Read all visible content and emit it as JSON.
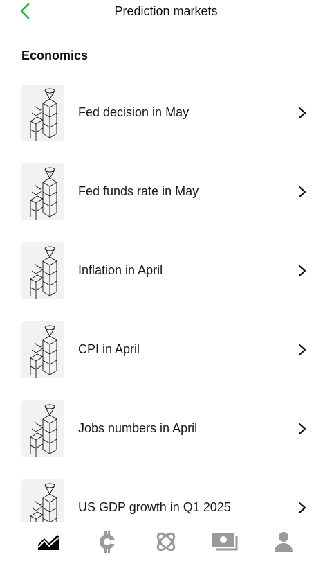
{
  "header": {
    "title": "Prediction markets",
    "back_icon": "chevron-left-icon",
    "accent_color": "#1db83a"
  },
  "section": {
    "title": "Economics"
  },
  "markets": [
    {
      "label": "Fed decision in May",
      "icon": "isometric-blocks-icon"
    },
    {
      "label": "Fed funds rate in May",
      "icon": "isometric-blocks-icon"
    },
    {
      "label": "Inflation in April",
      "icon": "isometric-blocks-icon"
    },
    {
      "label": "CPI in April",
      "icon": "isometric-blocks-icon"
    },
    {
      "label": "Jobs numbers in April",
      "icon": "isometric-blocks-icon"
    },
    {
      "label": "US GDP growth in Q1 2025",
      "icon": "isometric-blocks-icon"
    }
  ],
  "nav": {
    "items": [
      {
        "icon": "chart-trend-icon",
        "active": true
      },
      {
        "icon": "bitcoin-icon",
        "active": false
      },
      {
        "icon": "atom-icon",
        "active": false
      },
      {
        "icon": "cash-icon",
        "active": false
      },
      {
        "icon": "profile-icon",
        "active": false
      }
    ],
    "active_color": "#000000",
    "inactive_color": "#9a9a9a"
  }
}
